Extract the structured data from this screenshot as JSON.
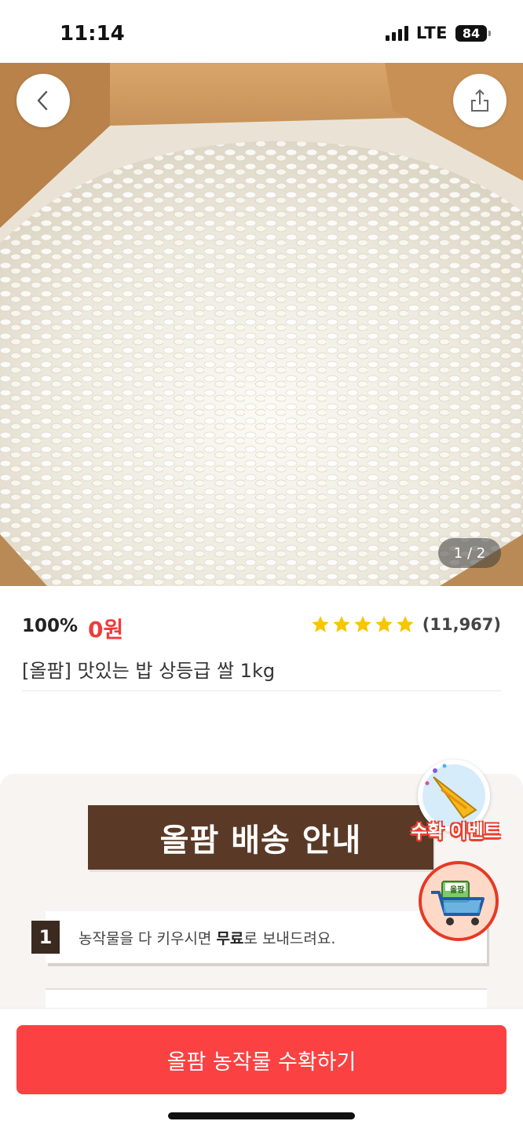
{
  "status_bar": {
    "time": "11:14",
    "network": "LTE",
    "battery": "84"
  },
  "hero": {
    "page_indicator": "1 / 2"
  },
  "product": {
    "discount": "100%",
    "price": "0원",
    "rating_stars": 5,
    "review_count": "(11,967)",
    "title": "[올팜] 맛있는 밥 상등급 쌀 1kg"
  },
  "guide": {
    "banner_title": "올팜 배송 안내",
    "steps": [
      {
        "number": "1",
        "text_before": "농작물을 다 키우시면 ",
        "text_bold": "무료",
        "text_after": "로 보내드려요."
      }
    ]
  },
  "floating": {
    "event_label": "수확 이벤트",
    "cart_tag": "올팜"
  },
  "bottom": {
    "harvest_button_label": "올팜 농작물 수확하기"
  },
  "colors": {
    "accent_red": "#fb4141",
    "price_red": "#f23a3a",
    "banner_brown": "#5a3a27",
    "star_yellow": "#f7c600"
  },
  "icons": [
    "back-chevron-icon",
    "share-icon",
    "star-icon",
    "party-popper-icon",
    "shopping-cart-icon"
  ]
}
